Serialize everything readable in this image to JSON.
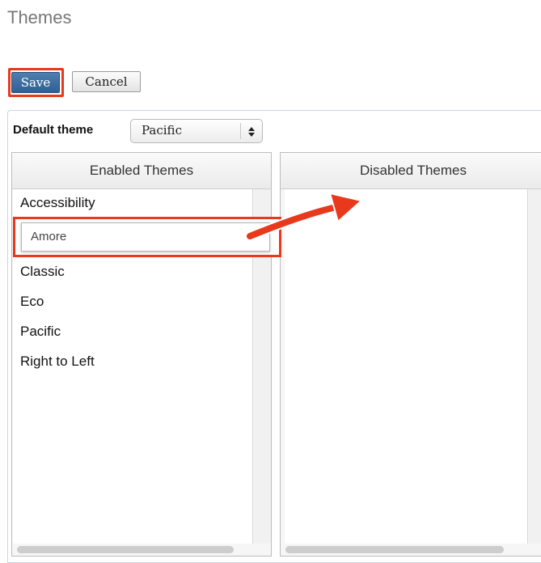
{
  "page": {
    "title": "Themes"
  },
  "toolbar": {
    "save_label": "Save",
    "cancel_label": "Cancel"
  },
  "default_theme": {
    "label": "Default theme",
    "selected": "Pacific"
  },
  "enabled": {
    "header": "Enabled Themes",
    "items": [
      "Accessibility",
      "Amore",
      "Classic",
      "Eco",
      "Pacific",
      "Right to Left"
    ]
  },
  "disabled": {
    "header": "Disabled Themes",
    "items": []
  },
  "drag": {
    "label": "Amore"
  },
  "colors": {
    "highlight": "#e8391d",
    "save_button": "#3a6aa0"
  },
  "icons": {
    "select_arrows": "updown-arrows-icon",
    "drag_arrow": "arrow-right-icon"
  }
}
